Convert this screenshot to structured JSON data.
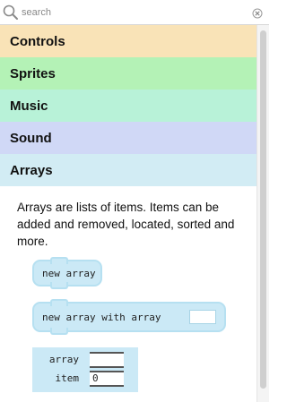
{
  "search": {
    "placeholder": "search"
  },
  "categories": [
    {
      "label": "Controls",
      "color": "#f9e3b7"
    },
    {
      "label": "Sprites",
      "color": "#b4f2b6"
    },
    {
      "label": "Music",
      "color": "#b8f2d8"
    },
    {
      "label": "Sound",
      "color": "#d0d8f6"
    },
    {
      "label": "Arrays",
      "color": "#d2ecf4"
    }
  ],
  "arrays_panel": {
    "description": "Arrays are lists of items. Items can be added and removed, located, sorted and more.",
    "blocks": [
      {
        "label": "new array"
      },
      {
        "label": "new array with array",
        "slot_value": ""
      }
    ],
    "variables": [
      {
        "label": "array",
        "value": ""
      },
      {
        "label": "item",
        "value": "0"
      }
    ]
  },
  "colors": {
    "block_fill": "#cbe9f6",
    "block_border": "#b6e0f1"
  },
  "icons": {
    "search": "search-icon",
    "clear": "clear-search-icon"
  }
}
